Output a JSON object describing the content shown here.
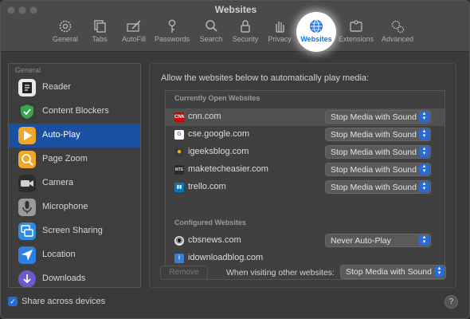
{
  "window": {
    "title": "Websites"
  },
  "toolbar": {
    "items": [
      {
        "label": "General",
        "icon": "gear-icon"
      },
      {
        "label": "Tabs",
        "icon": "tabs-icon"
      },
      {
        "label": "AutoFill",
        "icon": "pencil-icon"
      },
      {
        "label": "Passwords",
        "icon": "key-icon"
      },
      {
        "label": "Search",
        "icon": "search-icon"
      },
      {
        "label": "Security",
        "icon": "lock-icon"
      },
      {
        "label": "Privacy",
        "icon": "hand-icon"
      },
      {
        "label": "Websites",
        "icon": "globe-icon",
        "selected": true
      },
      {
        "label": "Extensions",
        "icon": "puzzle-icon"
      },
      {
        "label": "Advanced",
        "icon": "gears-icon"
      }
    ]
  },
  "sidebar": {
    "header": "General",
    "items": [
      {
        "label": "Reader",
        "icon": "reader-icon",
        "color": "#e8e8e8"
      },
      {
        "label": "Content Blockers",
        "icon": "shield-check-icon",
        "color": "#3aa64a"
      },
      {
        "label": "Auto-Play",
        "icon": "play-icon",
        "color": "#f0a62a",
        "selected": true
      },
      {
        "label": "Page Zoom",
        "icon": "magnifier-icon",
        "color": "#f0a62a"
      },
      {
        "label": "Camera",
        "icon": "camera-icon",
        "color": "#2d2d2d"
      },
      {
        "label": "Microphone",
        "icon": "microphone-icon",
        "color": "#9a9a9a"
      },
      {
        "label": "Screen Sharing",
        "icon": "screen-sharing-icon",
        "color": "#2f8ee0"
      },
      {
        "label": "Location",
        "icon": "location-arrow-icon",
        "color": "#2f7fe0"
      },
      {
        "label": "Downloads",
        "icon": "downloads-icon",
        "color": "#6a5acd"
      }
    ]
  },
  "main": {
    "heading": "Allow the websites below to automatically play media:",
    "open_section_title": "Currently Open Websites",
    "configured_section_title": "Configured Websites",
    "open_sites": [
      {
        "name": "cnn.com",
        "setting": "Stop Media with Sound",
        "favicon": "CNN",
        "favicon_color": "#cc0000",
        "highlight": true
      },
      {
        "name": "cse.google.com",
        "setting": "Stop Media with Sound",
        "favicon": "G",
        "favicon_color": "#ffffff"
      },
      {
        "name": "igeeksblog.com",
        "setting": "Stop Media with Sound",
        "favicon": "●",
        "favicon_color": "#f0b400"
      },
      {
        "name": "maketecheasier.com",
        "setting": "Stop Media with Sound",
        "favicon": "MTE",
        "favicon_color": "#333333"
      },
      {
        "name": "trello.com",
        "setting": "Stop Media with Sound",
        "favicon": "▮▮",
        "favicon_color": "#0079bf"
      }
    ],
    "configured_sites": [
      {
        "name": "cbsnews.com",
        "setting": "Never Auto-Play",
        "favicon": "◉",
        "favicon_color": "#111111"
      },
      {
        "name": "idownloadblog.com",
        "setting": "",
        "favicon": "i",
        "favicon_color": "#3b7dd8"
      }
    ],
    "remove_label": "Remove",
    "other_label": "When visiting other websites:",
    "other_setting": "Stop Media with Sound"
  },
  "footer": {
    "share_label": "Share across devices",
    "share_checked": true,
    "help_label": "?"
  },
  "colors": {
    "accent": "#2a6ad2",
    "selection": "#1b4fa0"
  }
}
